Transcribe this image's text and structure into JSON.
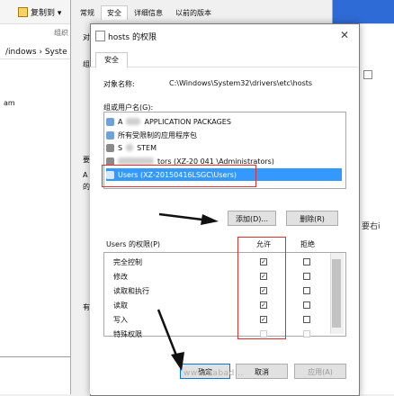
{
  "background": {
    "toolbar_copy_label": "复制到 ▾",
    "organize_label": "组织",
    "address_text": "/indows › Syste",
    "left_item_text": "am"
  },
  "properties_dialog": {
    "tabs": [
      "常规",
      "安全",
      "详细信息",
      "以前的版本"
    ],
    "left_labels": [
      "对",
      "组",
      "要",
      "A",
      "的",
      "有"
    ]
  },
  "permissions_dialog": {
    "title": "hosts 的权限",
    "tab_label": "安全",
    "object_name_label": "对象名称:",
    "object_name_value": "C:\\Windows\\System32\\drivers\\etc\\hosts",
    "group_label": "组或用户名(G):",
    "groups": [
      {
        "name_before": "A",
        "name_after": "APPLICATION PACKAGES",
        "icon": "package-group-icon"
      },
      {
        "name_before": "所有受限制的应用程序包",
        "name_after": "",
        "icon": "package-group-icon"
      },
      {
        "name_before": "S",
        "name_after": "STEM",
        "icon": "user-group-icon"
      },
      {
        "name_before": "",
        "name_after": "tors (XZ-20  041  \\Administrators)",
        "icon": "user-group-icon"
      },
      {
        "name_before": "Users (XZ-20150416LSGC\\Users)",
        "name_after": "",
        "icon": "user-group-icon",
        "selected": true
      }
    ],
    "add_button": "添加(D)...",
    "remove_button": "删除(R)",
    "permissions_label": "Users 的权限(P)",
    "allow_header": "允许",
    "deny_header": "拒绝",
    "permissions": [
      {
        "name": "完全控制",
        "allow": true,
        "deny": false
      },
      {
        "name": "修改",
        "allow": true,
        "deny": false
      },
      {
        "name": "读取和执行",
        "allow": true,
        "deny": false
      },
      {
        "name": "读取",
        "allow": true,
        "deny": false
      },
      {
        "name": "写入",
        "allow": true,
        "deny": false
      },
      {
        "name": "特殊权限",
        "allow": false,
        "deny": false
      }
    ],
    "ok_button": "确定",
    "cancel_button": "取消",
    "apply_button": "应用(A)"
  },
  "right_partial_text": "要右i",
  "watermark": "www.babad..."
}
